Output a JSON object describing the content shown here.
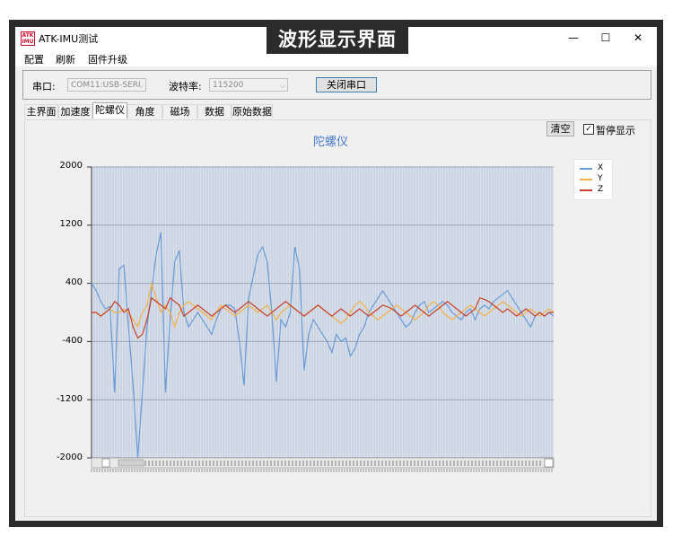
{
  "banner": {
    "text": "波形显示界面"
  },
  "window": {
    "icon_text": "ATK\nIMU",
    "title": "ATK-IMU测试",
    "controls": {
      "minimize": "—",
      "maximize": "☐",
      "close": "✕"
    }
  },
  "menu": {
    "items": [
      "配置",
      "刷新",
      "固件升级"
    ]
  },
  "serial": {
    "port_label": "串口:",
    "port_value": "COM11:USB-SERI",
    "baud_label": "波特率:",
    "baud_value": "115200",
    "close_button": "关闭串口"
  },
  "tabs": [
    {
      "label": "主界面",
      "active": false
    },
    {
      "label": "加速度",
      "active": false
    },
    {
      "label": "陀螺仪",
      "active": true
    },
    {
      "label": "角度",
      "active": false
    },
    {
      "label": "磁场",
      "active": false
    },
    {
      "label": "数据",
      "active": false
    },
    {
      "label": "原始数据",
      "active": false
    }
  ],
  "controls": {
    "clear_button": "清空",
    "pause_label": "暂停显示",
    "pause_checked": true
  },
  "chart_data": {
    "type": "line",
    "title": "陀螺仪",
    "xlabel": "",
    "ylabel": "",
    "ylim": [
      -2000,
      2000
    ],
    "yticks": [
      2000,
      1200,
      400,
      -400,
      -1200,
      -2000
    ],
    "ytick_labels": [
      "2000",
      "1200",
      "400",
      "-400",
      "-1200",
      "-2000"
    ],
    "grid": true,
    "legend": "top-right",
    "x": [
      0,
      1,
      2,
      3,
      4,
      5,
      6,
      7,
      8,
      9,
      10,
      11,
      12,
      13,
      14,
      15,
      16,
      17,
      18,
      19,
      20,
      21,
      22,
      23,
      24,
      25,
      26,
      27,
      28,
      29,
      30,
      31,
      32,
      33,
      34,
      35,
      36,
      37,
      38,
      39,
      40,
      41,
      42,
      43,
      44,
      45,
      46,
      47,
      48,
      49,
      50,
      51,
      52,
      53,
      54,
      55,
      56,
      57,
      58,
      59,
      60,
      61,
      62,
      63,
      64,
      65,
      66,
      67,
      68,
      69,
      70,
      71,
      72,
      73,
      74,
      75,
      76,
      77,
      78,
      79,
      80,
      81,
      82,
      83,
      84,
      85,
      86,
      87,
      88,
      89,
      90,
      91,
      92,
      93,
      94,
      95,
      96,
      97,
      98,
      99,
      100
    ],
    "series": [
      {
        "name": "X",
        "color": "#6a9bd8",
        "values": [
          400,
          300,
          150,
          50,
          80,
          -1100,
          600,
          650,
          -200,
          -1000,
          -2000,
          -1100,
          -200,
          300,
          800,
          1100,
          -1100,
          -100,
          700,
          850,
          0,
          -200,
          -100,
          0,
          -100,
          -200,
          -300,
          -100,
          50,
          100,
          100,
          50,
          -400,
          -1000,
          200,
          500,
          800,
          900,
          700,
          0,
          -950,
          -100,
          -200,
          0,
          900,
          600,
          -800,
          -300,
          -100,
          -200,
          -300,
          -400,
          -550,
          -300,
          -400,
          -350,
          -600,
          -500,
          -300,
          -200,
          0,
          100,
          200,
          300,
          200,
          100,
          0,
          -100,
          -200,
          -150,
          0,
          100,
          150,
          0,
          50,
          100,
          150,
          100,
          0,
          -50,
          -100,
          0,
          50,
          -100,
          50,
          100,
          50,
          150,
          200,
          250,
          300,
          200,
          100,
          0,
          -100,
          -200,
          -50,
          0,
          -50,
          0,
          -50
        ]
      },
      {
        "name": "Y",
        "color": "#f5b14a",
        "values": [
          0,
          0,
          -50,
          0,
          50,
          0,
          0,
          50,
          0,
          -100,
          -200,
          0,
          100,
          400,
          200,
          0,
          100,
          0,
          -200,
          0,
          100,
          150,
          100,
          50,
          0,
          -50,
          -100,
          0,
          100,
          50,
          0,
          -50,
          0,
          50,
          100,
          50,
          0,
          50,
          100,
          0,
          -100,
          0,
          50,
          100,
          50,
          0,
          -50,
          0,
          50,
          100,
          50,
          0,
          -50,
          -100,
          -150,
          -100,
          0,
          100,
          150,
          100,
          0,
          -50,
          -100,
          -50,
          0,
          50,
          100,
          50,
          0,
          -50,
          -100,
          -50,
          0,
          100,
          150,
          100,
          0,
          -50,
          -100,
          -50,
          0,
          50,
          100,
          50,
          0,
          -50,
          0,
          50,
          100,
          150,
          100,
          50,
          0,
          -50,
          0,
          50,
          0,
          -50,
          0,
          50,
          0
        ]
      },
      {
        "name": "Z",
        "color": "#c9402a",
        "values": [
          0,
          0,
          -50,
          0,
          50,
          150,
          100,
          0,
          50,
          -200,
          -350,
          -300,
          -100,
          200,
          150,
          100,
          50,
          200,
          150,
          100,
          -50,
          0,
          50,
          100,
          50,
          0,
          -50,
          0,
          50,
          100,
          50,
          0,
          50,
          100,
          150,
          100,
          50,
          0,
          -50,
          0,
          50,
          100,
          150,
          100,
          50,
          0,
          -50,
          0,
          50,
          100,
          50,
          0,
          -50,
          0,
          50,
          0,
          -50,
          0,
          50,
          0,
          -50,
          0,
          50,
          100,
          80,
          50,
          0,
          -50,
          0,
          50,
          100,
          50,
          0,
          -50,
          0,
          50,
          100,
          150,
          100,
          50,
          0,
          -50,
          0,
          50,
          200,
          180,
          150,
          100,
          50,
          0,
          50,
          0,
          -50,
          0,
          50,
          0,
          -50,
          0,
          -50,
          0,
          0
        ]
      }
    ]
  }
}
